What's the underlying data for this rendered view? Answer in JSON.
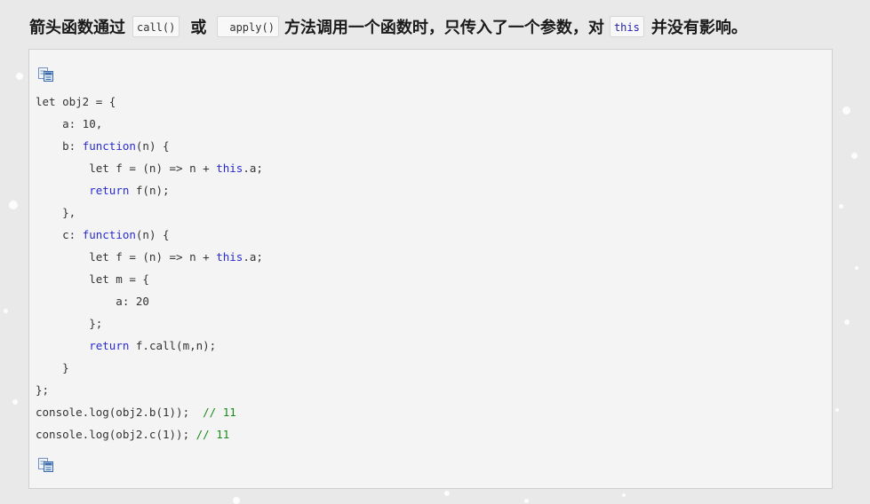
{
  "heading": {
    "part1": "箭头函数通过",
    "code_call": "call()",
    "part2": "或",
    "code_apply": "apply()",
    "part3": "方法调用一个函数时，只传入了一个参数，对",
    "code_this": "this",
    "part4": "并没有影响。"
  },
  "code": {
    "lines": [
      [
        {
          "t": "let obj2 = {",
          "c": "plain"
        }
      ],
      [
        {
          "t": "    a: 10,",
          "c": "plain"
        }
      ],
      [
        {
          "t": "    b: ",
          "c": "plain"
        },
        {
          "t": "function",
          "c": "kw"
        },
        {
          "t": "(n) {",
          "c": "plain"
        }
      ],
      [
        {
          "t": "        let f = (n) => n + ",
          "c": "plain"
        },
        {
          "t": "this",
          "c": "kw"
        },
        {
          "t": ".a;",
          "c": "plain"
        }
      ],
      [
        {
          "t": "        ",
          "c": "plain"
        },
        {
          "t": "return",
          "c": "kw"
        },
        {
          "t": " f(n);",
          "c": "plain"
        }
      ],
      [
        {
          "t": "    },",
          "c": "plain"
        }
      ],
      [
        {
          "t": "    c: ",
          "c": "plain"
        },
        {
          "t": "function",
          "c": "kw"
        },
        {
          "t": "(n) {",
          "c": "plain"
        }
      ],
      [
        {
          "t": "        let f = (n) => n + ",
          "c": "plain"
        },
        {
          "t": "this",
          "c": "kw"
        },
        {
          "t": ".a;",
          "c": "plain"
        }
      ],
      [
        {
          "t": "        let m = {",
          "c": "plain"
        }
      ],
      [
        {
          "t": "            a: 20",
          "c": "plain"
        }
      ],
      [
        {
          "t": "        };",
          "c": "plain"
        }
      ],
      [
        {
          "t": "        ",
          "c": "plain"
        },
        {
          "t": "return",
          "c": "kw"
        },
        {
          "t": " f.call(m,n);",
          "c": "plain"
        }
      ],
      [
        {
          "t": "    }",
          "c": "plain"
        }
      ],
      [
        {
          "t": "};",
          "c": "plain"
        }
      ],
      [
        {
          "t": "console.log(obj2.b(1));  ",
          "c": "plain"
        },
        {
          "t": "// 11",
          "c": "cm"
        }
      ],
      [
        {
          "t": "console.log(obj2.c(1)); ",
          "c": "plain"
        },
        {
          "t": "// 11",
          "c": "cm"
        }
      ]
    ]
  },
  "icons": {
    "copy_top": "copy-code-icon",
    "copy_bottom": "copy-code-icon"
  },
  "colors": {
    "keyword": "#2b2bd0",
    "comment": "#1a8a1a",
    "text": "#333333",
    "code_background": "#f4f4f4",
    "page_background": "#e9e9e9"
  }
}
